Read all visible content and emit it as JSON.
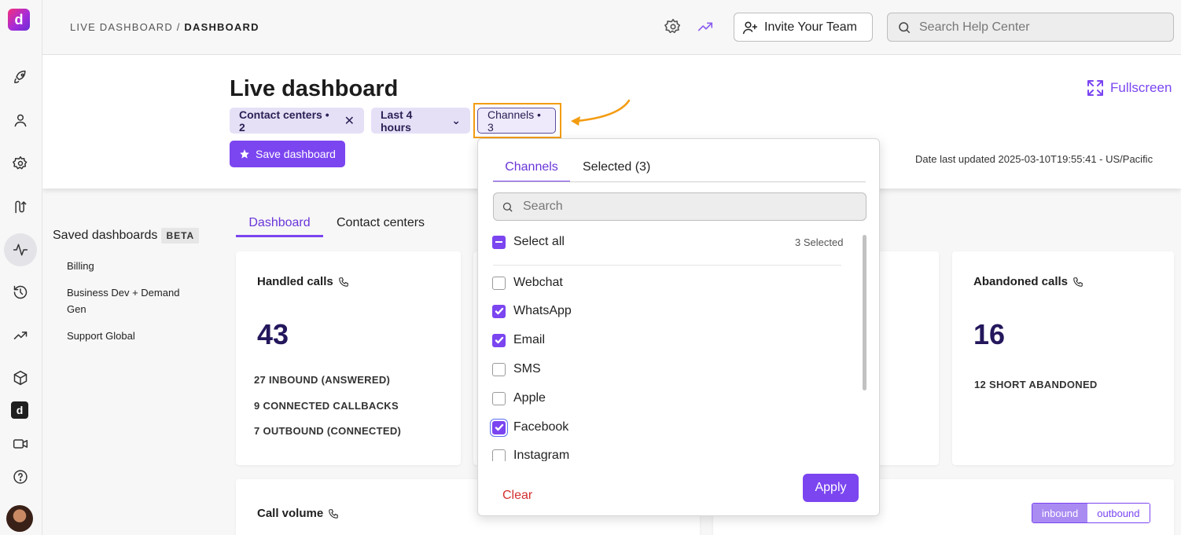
{
  "app": {
    "logo_letter": "d"
  },
  "breadcrumb": {
    "parent": "LIVE DASHBOARD",
    "separator": "/",
    "current": "DASHBOARD"
  },
  "topbar": {
    "invite_label": "Invite Your Team",
    "help_search_placeholder": "Search Help Center"
  },
  "header": {
    "title": "Live dashboard",
    "chips": {
      "contact_centers": "Contact centers • 2",
      "time_range": "Last 4 hours",
      "channels": "Channels • 3"
    },
    "save_label": "Save dashboard",
    "fullscreen_label": "Fullscreen",
    "updated": "Date last updated 2025-03-10T19:55:41 - US/Pacific"
  },
  "saved": {
    "title": "Saved dashboards",
    "badge": "BETA",
    "items": [
      "Billing",
      "Business Dev + Demand Gen",
      "Support Global"
    ]
  },
  "tabs": {
    "dashboard": "Dashboard",
    "contact_centers": "Contact centers"
  },
  "cards": {
    "handled": {
      "title": "Handled calls",
      "value": "43",
      "stats": [
        "27 INBOUND (ANSWERED)",
        "9 CONNECTED CALLBACKS",
        "7 OUTBOUND (CONNECTED)"
      ]
    },
    "abandoned": {
      "title": "Abandoned calls",
      "value": "16",
      "stats": [
        "12 SHORT ABANDONED"
      ]
    },
    "volume": {
      "title": "Call volume"
    },
    "duration": {
      "inbound": "inbound",
      "outbound": "outbound"
    }
  },
  "dropdown": {
    "tabs": {
      "channels": "Channels",
      "selected": "Selected (3)"
    },
    "search_placeholder": "Search",
    "select_all": "Select all",
    "selected_count": "3 Selected",
    "options": [
      {
        "label": "Webchat",
        "checked": false
      },
      {
        "label": "WhatsApp",
        "checked": true
      },
      {
        "label": "Email",
        "checked": true
      },
      {
        "label": "SMS",
        "checked": false
      },
      {
        "label": "Apple",
        "checked": false
      },
      {
        "label": "Facebook",
        "checked": true
      },
      {
        "label": "Instagram",
        "checked": false
      }
    ],
    "clear_label": "Clear",
    "apply_label": "Apply"
  },
  "colors": {
    "accent": "#7b45f0",
    "danger": "#d32f2f",
    "annotation": "#f39c12",
    "number": "#24175c"
  }
}
